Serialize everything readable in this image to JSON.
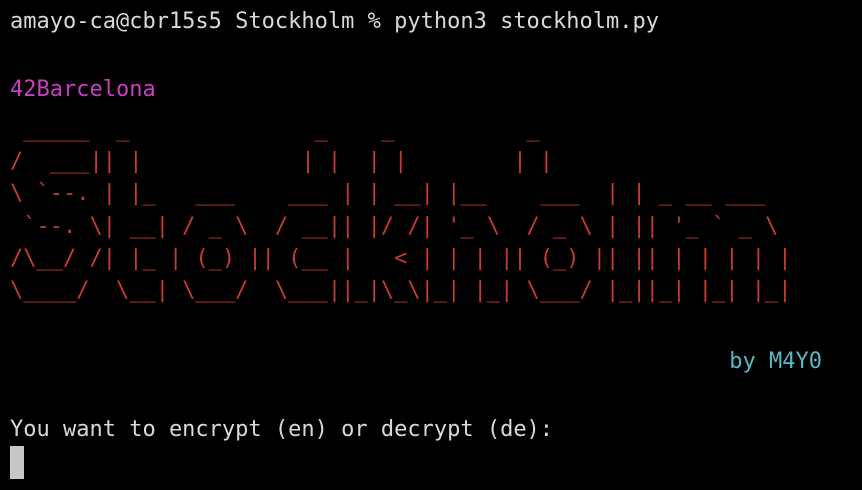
{
  "terminal": {
    "prompt": "amayo-ca@cbr15s5 Stockholm % python3 stockholm.py",
    "brand": "42Barcelona",
    "banner_ascii": " _____  _              _    _          _\n/  ___|| |            | |  | |        | |\n\\ `--. | |_   ___    ___ | | __| |__    ___  | | _ __ ___\n `--. \\| __| / _ \\  / __|| |/ /| '_ \\  / _ \\ | || '_ ` _ \\\n/\\__/ /| |_ | (_) || (__ |   < | | | || (_) || || | | | | |\n\\____/  \\__| \\___/  \\___||_|\\_\\|_| |_| \\___/ |_||_| |_| |_|",
    "byline": "by M4Y0",
    "question": "You want to encrypt (en) or decrypt (de):"
  },
  "colors": {
    "background": "#000000",
    "text": "#d9d9d9",
    "brand": "#c93fc2",
    "banner": "#c53a31",
    "byline": "#58b9c5",
    "cursor": "#c7c7c7"
  }
}
